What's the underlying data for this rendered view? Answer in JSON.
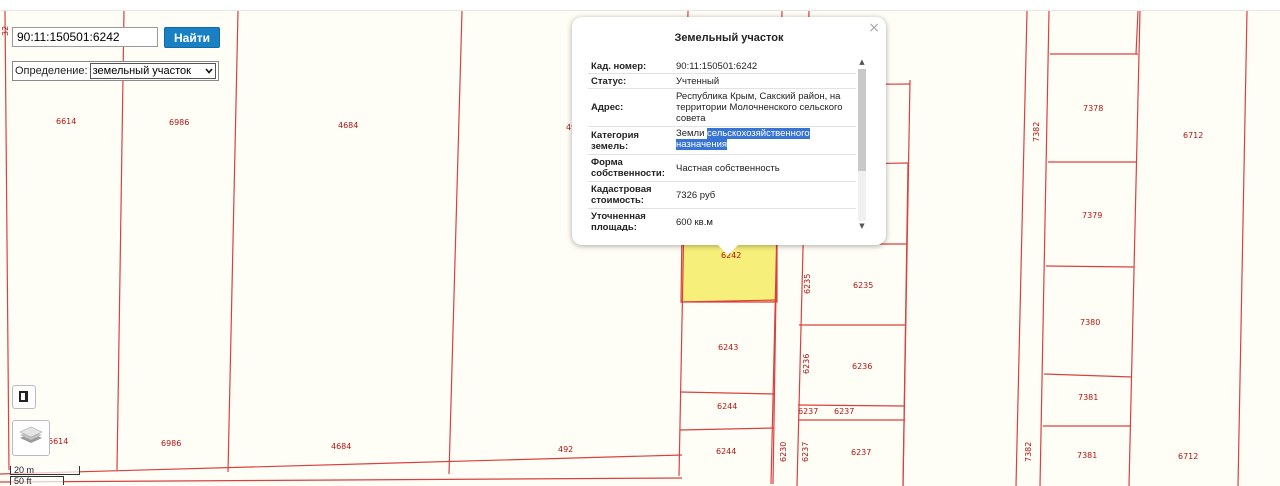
{
  "search": {
    "value": "90:11:150501:6242",
    "button_label": "Найти",
    "definition_label": "Определение:",
    "definition_value": "земельный участок",
    "dropdown_arrow": "chevron-down-icon"
  },
  "popup": {
    "title": "Земельный участок",
    "close": "×",
    "rows": [
      {
        "key": "Кад. номер:",
        "value": "90:11:150501:6242"
      },
      {
        "key": "Статус:",
        "value": "Учтенный"
      },
      {
        "key": "Адрес:",
        "value": "Республика Крым, Сакский район, на территории Молочненского сельского совета"
      },
      {
        "key": "Категория земель:",
        "value_prefix": "Земли",
        "value_highlight": "сельскохозяйственного назначения"
      },
      {
        "key": "Форма собственности:",
        "value": "Частная собственность"
      },
      {
        "key": "Кадастровая стоимость:",
        "value": "7326 руб"
      },
      {
        "key": "Уточненная площадь:",
        "value": "600 кв.м"
      }
    ]
  },
  "map": {
    "selected_parcel_color": "#f6ef7a",
    "boundary_color": "#d94040",
    "label_color": "#b01515",
    "labels": {
      "l_6614_top": "6614",
      "l_6986_top": "6986",
      "l_4684_top": "4684",
      "l_49_top": "49",
      "l_6614_bot": "6614",
      "l_6986_bot": "6986",
      "l_4684_bot": "4684",
      "l_492_bot": "492",
      "l_6242": "6242",
      "l_6243": "6243",
      "l_6244a": "6244",
      "l_6244b": "6244",
      "l_6235v": "6235",
      "l_6235": "6235",
      "l_6236v": "6236",
      "l_6236": "6236",
      "l_6237a": "6237",
      "l_6237b": "6237",
      "l_6237v": "6237",
      "l_6237c": "6237",
      "l_6230v": "6230",
      "l_7382a": "7382",
      "l_7382b": "7382",
      "l_7378": "7378",
      "l_7379": "7379",
      "l_7380": "7380",
      "l_7381a": "7381",
      "l_7381b": "7381",
      "l_6712a": "6712",
      "l_6712b": "6712",
      "l_edge": "32"
    }
  },
  "scale": {
    "upper": "20 m",
    "lower": "50 ft"
  },
  "controls": {
    "fullscreen_icon": "fullscreen-icon",
    "layers_icon": "layers-icon"
  }
}
